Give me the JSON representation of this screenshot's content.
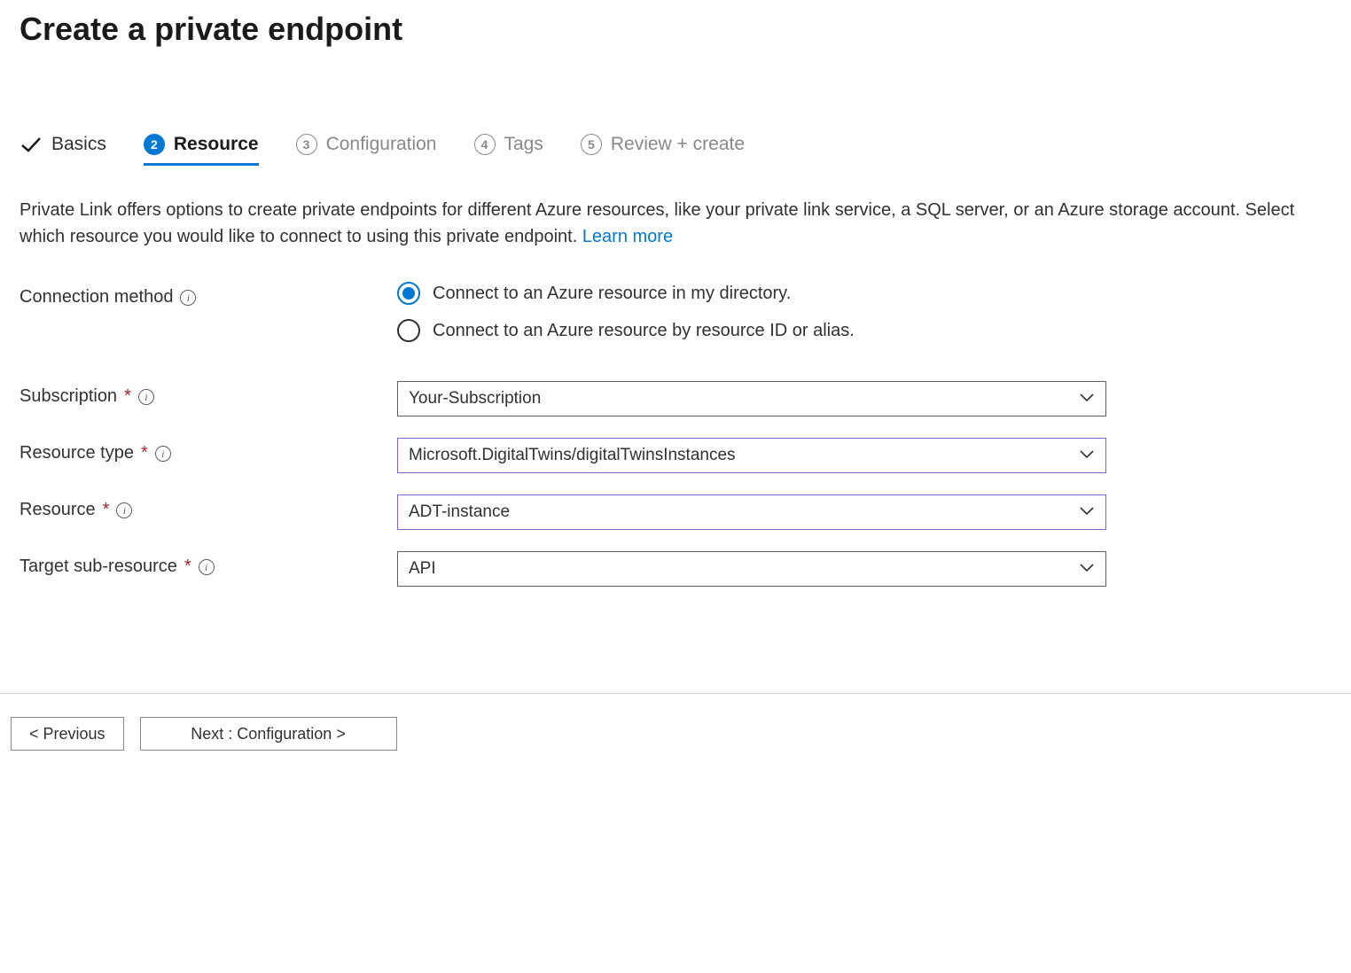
{
  "page": {
    "title": "Create a private endpoint"
  },
  "tabs": [
    {
      "label": "Basics",
      "state": "completed"
    },
    {
      "label": "Resource",
      "state": "active",
      "number": "2"
    },
    {
      "label": "Configuration",
      "state": "pending",
      "number": "3"
    },
    {
      "label": "Tags",
      "state": "pending",
      "number": "4"
    },
    {
      "label": "Review + create",
      "state": "pending",
      "number": "5"
    }
  ],
  "description": {
    "text": "Private Link offers options to create private endpoints for different Azure resources, like your private link service, a SQL server, or an Azure storage account. Select which resource you would like to connect to using this private endpoint.  ",
    "link_text": "Learn more"
  },
  "fields": {
    "connection_method": {
      "label": "Connection method",
      "options": [
        "Connect to an Azure resource in my directory.",
        "Connect to an Azure resource by resource ID or alias."
      ],
      "selected_index": 0
    },
    "subscription": {
      "label": "Subscription",
      "value": "Your-Subscription",
      "required": true
    },
    "resource_type": {
      "label": "Resource type",
      "value": "Microsoft.DigitalTwins/digitalTwinsInstances",
      "required": true
    },
    "resource": {
      "label": "Resource",
      "value": "ADT-instance",
      "required": true
    },
    "target_sub_resource": {
      "label": "Target sub-resource",
      "value": "API",
      "required": true
    }
  },
  "footer": {
    "previous": "< Previous",
    "next": "Next : Configuration >"
  }
}
